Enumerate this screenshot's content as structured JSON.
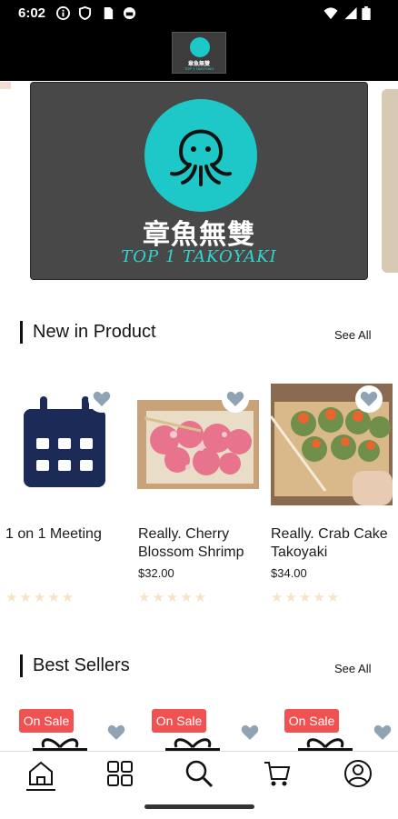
{
  "status_bar": {
    "time": "6:02"
  },
  "logo": {
    "top_text": "章魚無雙",
    "bottom_text": "TOP 1 TAKOYAKI"
  },
  "banner": {
    "title_zh": "章魚無雙",
    "subtitle": "TOP 1 TAKOYAKI"
  },
  "new_products": {
    "title": "New in Product",
    "see_all": "See All",
    "items": [
      {
        "name": "1 on 1 Meeting",
        "price": "",
        "rating": 0
      },
      {
        "name": "Really. Cherry Blossom Shrimp",
        "price": "$32.00",
        "rating": 0
      },
      {
        "name": "Really. Crab Cake Takoyaki",
        "price": "$34.00",
        "rating": 0
      }
    ]
  },
  "best_sellers": {
    "title": "Best Sellers",
    "see_all": "See All",
    "badges": [
      "On Sale",
      "On Sale",
      "On Sale"
    ]
  },
  "colors": {
    "accent": "#1ec8c8",
    "sale": "#f05252",
    "calendar": "#1b2a57",
    "heart": "#8fa3b4",
    "star": "#f7e3c7"
  },
  "icons": [
    "home-icon",
    "categories-icon",
    "search-icon",
    "cart-icon",
    "profile-icon"
  ]
}
